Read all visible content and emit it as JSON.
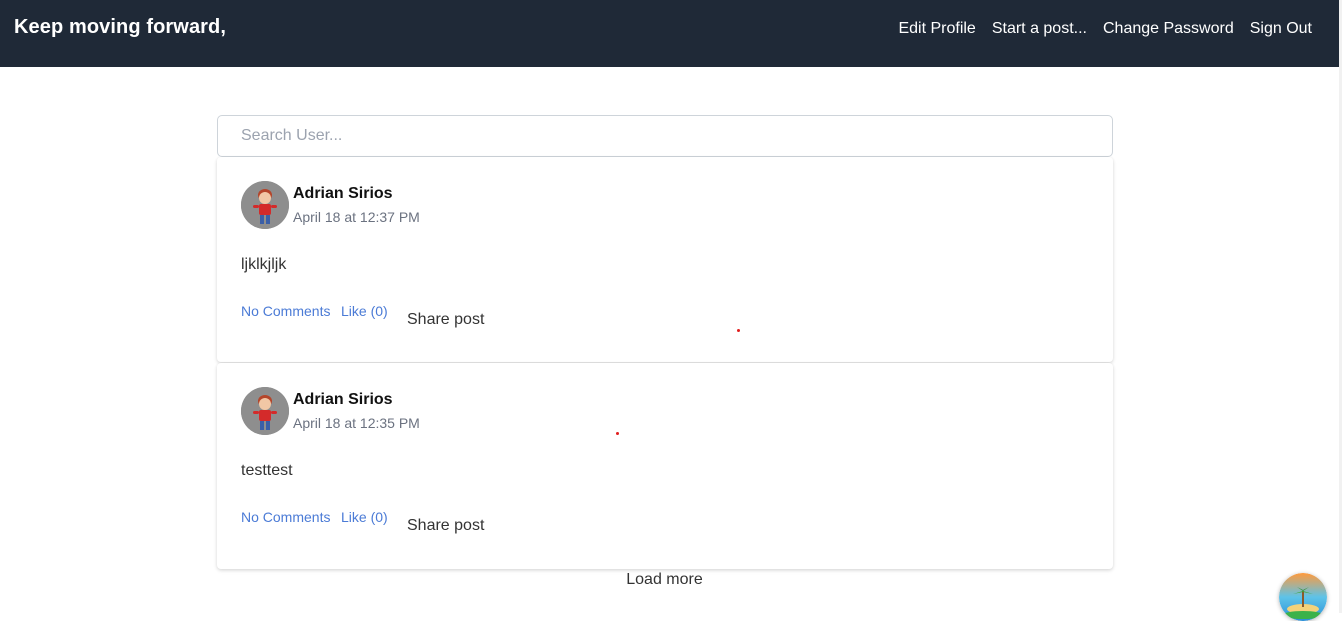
{
  "navbar": {
    "brand": "Keep moving forward,",
    "links": [
      "Edit Profile",
      "Start a post...",
      "Change Password",
      "Sign Out"
    ]
  },
  "search": {
    "placeholder": "Search User..."
  },
  "posts": [
    {
      "author": "Adrian Sirios",
      "date": "April 18 at 12:37 PM",
      "body": "ljklkjljk",
      "comments": "No Comments",
      "like": "Like (0)",
      "share": "Share post"
    },
    {
      "author": "Adrian Sirios",
      "date": "April 18 at 12:35 PM",
      "body": "testtest",
      "comments": "No Comments",
      "like": "Like (0)",
      "share": "Share post"
    }
  ],
  "load_more": "Load more",
  "colors": {
    "navbar_bg": "#1f2937",
    "link": "#4b7bd6"
  },
  "icons": [
    "user-avatar-icon",
    "floating-island-icon"
  ]
}
